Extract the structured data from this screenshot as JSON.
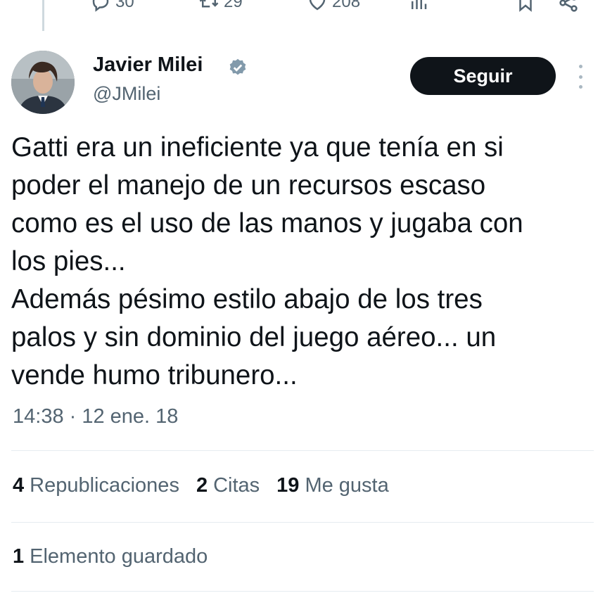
{
  "top_actions": {
    "reply_count": "30",
    "repost_count": "29",
    "like_count": "208"
  },
  "author": {
    "display_name": "Javier Milei",
    "handle": "@JMilei",
    "verified": true,
    "verified_color": "#829aab"
  },
  "follow_button": {
    "label": "Seguir",
    "bg_color": "#0f1419"
  },
  "tweet": {
    "lines": [
      "Gatti era un ineficiente ya que tenía en si",
      "poder el manejo de un recursos escaso",
      "como es el uso de las manos y jugaba con",
      "los pies...",
      "Además pésimo estilo abajo de los tres",
      "palos y sin dominio del juego aéreo... un",
      "vende humo tribunero..."
    ],
    "timestamp": "14:38 · 12 ene. 18"
  },
  "stats": {
    "reposts": {
      "count": "4",
      "label": "Republicaciones"
    },
    "quotes": {
      "count": "2",
      "label": "Citas"
    },
    "likes": {
      "count": "19",
      "label": "Me gusta"
    },
    "bookmarks": {
      "count": "1",
      "label": "Elemento guardado"
    }
  },
  "icons": [
    "reply-icon",
    "repost-icon",
    "like-icon",
    "views-icon",
    "bookmark-icon",
    "share-icon",
    "verified-badge-icon",
    "more-options-icon"
  ]
}
